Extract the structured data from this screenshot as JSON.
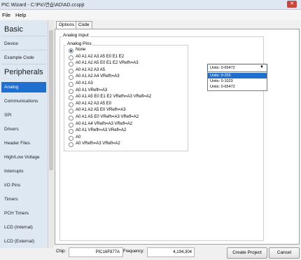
{
  "window": {
    "title": "PIC Wizard - C:\\Pic\\연습\\AD\\AD.ccspjt",
    "close_label": "✕"
  },
  "menu": {
    "items": [
      "File",
      "Help"
    ]
  },
  "sidebar": {
    "sections": {
      "basic": "Basic",
      "peripherals": "Peripherals"
    },
    "basic_items": [
      "Device",
      "Example Code"
    ],
    "items": [
      "Analog",
      "Communications",
      "SPI",
      "Drivers",
      "Header Files",
      "High/Low Voltage",
      "Interrupts",
      "I/O Pins",
      "Timers",
      "PCH Timers",
      "LCD (Internal)",
      "LCD (External)"
    ],
    "selected": "Analog"
  },
  "tabs": [
    "Options",
    "Code"
  ],
  "analog": {
    "group_label": "Analog Input",
    "pins_label": "Analog Pins",
    "selected_index": 0,
    "pins": [
      "None",
      "A0 A1 A2 A3 A5 E0 E1 E2",
      "A0 A1 A2 A5 E0 E1 E2 VRefh=A3",
      "A0 A1 A2 A3 A5",
      "A0 A1 A2 A4 VRefh=A3",
      "A0 A1 A3",
      "A0 A1 VRefh=A3",
      "A0 A1 A5 E0 E1 E2 VRefh=A3 VRefl=A2",
      "A0 A1 A2 A3 A5 E0",
      "A0 A1 A2 A5 E0 VRefh=A3",
      "A0 A1 A5 E0 VRefh=A3 VRefl=A2",
      "A0 A1 A4 VRefh=A3 VRefl=A2",
      "A0 A1 VRefh=A3 VRefl=A2",
      "A0",
      "A0 VRefh=A3 VRefl=A2"
    ],
    "units": {
      "current": "Units: 0-65472",
      "options": [
        "Units: 0-255",
        "Units: 0-1023",
        "Units: 0-65472"
      ],
      "highlighted_index": 0
    }
  },
  "status": {
    "chip_label": "Chip:",
    "chip_value": "PIC16F877A",
    "freq_label": "Frequency:",
    "freq_value": "4,194,304",
    "create_label": "Create Project",
    "cancel_label": "Cancel"
  },
  "colors": {
    "accent": "#1e6fd0",
    "sidebar_bg": "#dde8f3"
  }
}
